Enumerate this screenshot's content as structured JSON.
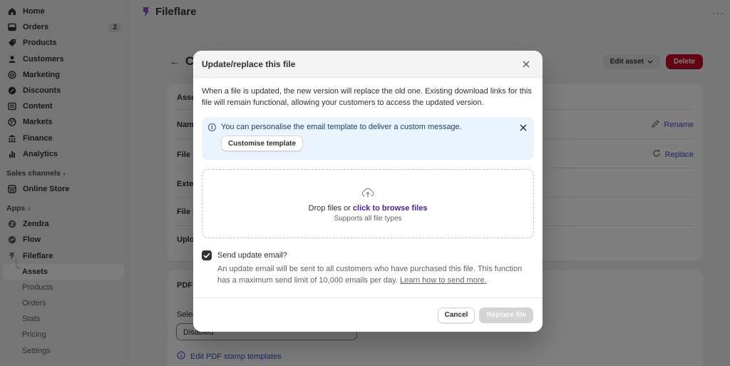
{
  "sidebar": {
    "items": [
      {
        "label": "Home",
        "icon": "home-icon"
      },
      {
        "label": "Orders",
        "icon": "orders-icon",
        "badge": "2"
      },
      {
        "label": "Products",
        "icon": "tag-icon"
      },
      {
        "label": "Customers",
        "icon": "person-icon"
      },
      {
        "label": "Marketing",
        "icon": "target-icon"
      },
      {
        "label": "Discounts",
        "icon": "discount-icon"
      },
      {
        "label": "Content",
        "icon": "content-icon"
      },
      {
        "label": "Markets",
        "icon": "globe-icon"
      },
      {
        "label": "Finance",
        "icon": "bank-icon"
      },
      {
        "label": "Analytics",
        "icon": "bar-chart-icon"
      }
    ],
    "sales_channels_label": "Sales channels",
    "online_store_label": "Online Store",
    "apps_label": "Apps",
    "apps": [
      {
        "label": "Zendra",
        "icon": "zendra-icon"
      },
      {
        "label": "Flow",
        "icon": "flow-icon"
      },
      {
        "label": "Fileflare",
        "icon": "fileflare-icon"
      }
    ],
    "sub_items": [
      "Assets",
      "Products",
      "Orders",
      "Stats",
      "Pricing",
      "Settings"
    ]
  },
  "main": {
    "app_title": "Fileflare",
    "page_title": "C",
    "edit_asset_label": "Edit asset",
    "delete_label": "Delete",
    "card1_header": "Asse",
    "rows": [
      "Nam",
      "File",
      "Exte",
      "File S",
      "Uplo"
    ],
    "rename_label": "Rename",
    "replace_label": "Replace",
    "card2_header": "PDF",
    "select_label": "Selec",
    "select_value": "Disabled",
    "edit_pdf_label": "Edit PDF stamp templates"
  },
  "modal": {
    "title": "Update/replace this file",
    "description": "When a file is updated, the new version will replace the old one. Existing download links for this file will remain functional, allowing your customers to access the updated version.",
    "banner_text": "You can personalise the email template to deliver a custom message.",
    "customise_label": "Customise template",
    "drop_prefix": "Drop files or ",
    "drop_link": "click to browse files",
    "drop_sub": "Supports all file types",
    "checkbox_label": "Send update email?",
    "checkbox_checked": true,
    "help_text": "An update email will be sent to all customers who have purchased this file. This function has a maximum send limit of 10,000 emails per day. ",
    "help_link": "Learn how to send more.",
    "cancel_label": "Cancel",
    "replace_label": "Replace file"
  },
  "colors": {
    "delete_red": "#c70a24",
    "link_purple": "#4a1fa8",
    "banner_bg": "#eaf4ff"
  }
}
